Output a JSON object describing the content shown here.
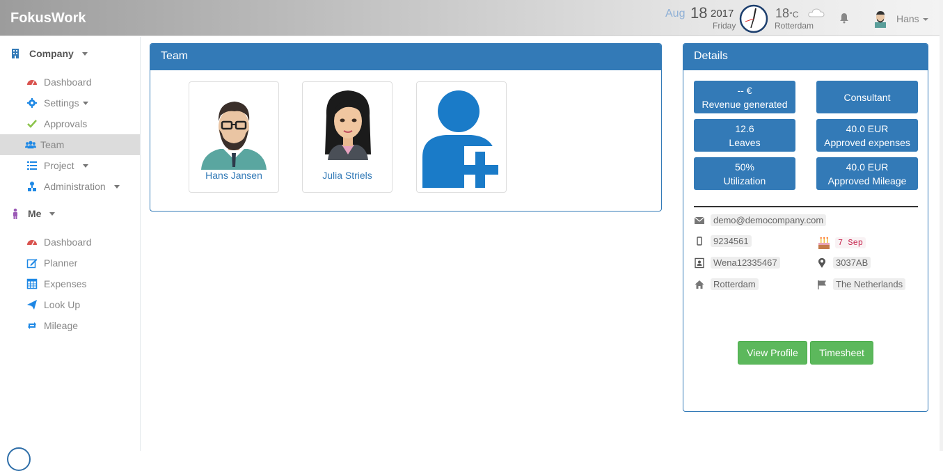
{
  "header": {
    "brand": "FokusWork",
    "date_month": "Aug",
    "date_day": "18",
    "date_year": "2017",
    "date_weekday": "Friday",
    "temperature": "18",
    "temperature_unit": "°C",
    "city": "Rotterdam",
    "user_name": "Hans"
  },
  "sidebar": {
    "company": {
      "label": "Company",
      "items": [
        {
          "label": "Dashboard",
          "icon": "dashboard-icon"
        },
        {
          "label": "Settings",
          "icon": "gear-icon"
        },
        {
          "label": "Approvals",
          "icon": "check-icon"
        },
        {
          "label": "Team",
          "icon": "users-icon"
        },
        {
          "label": "Project",
          "icon": "list-icon"
        },
        {
          "label": "Administration",
          "icon": "sitemap-icon"
        }
      ]
    },
    "me": {
      "label": "Me",
      "items": [
        {
          "label": "Dashboard",
          "icon": "dashboard-icon"
        },
        {
          "label": "Planner",
          "icon": "edit-icon"
        },
        {
          "label": "Expenses",
          "icon": "calculator-icon"
        },
        {
          "label": "Look Up",
          "icon": "paper-plane-icon"
        },
        {
          "label": "Mileage",
          "icon": "retweet-icon"
        }
      ]
    },
    "active_item": "Team"
  },
  "team": {
    "title": "Team",
    "members": [
      {
        "name": "Hans Jansen"
      },
      {
        "name": "Julia Striels"
      }
    ]
  },
  "details": {
    "title": "Details",
    "stats": [
      {
        "value": "-- €",
        "label": "Revenue generated"
      },
      {
        "value": "",
        "label": "Consultant"
      },
      {
        "value": "12.6",
        "label": "Leaves"
      },
      {
        "value": "40.0 EUR",
        "label": "Approved expenses"
      },
      {
        "value": "50%",
        "label": "Utilization"
      },
      {
        "value": "40.0 EUR",
        "label": "Approved Mileage"
      }
    ],
    "email": "demo@democompany.com",
    "phone": "9234561",
    "birthday": "7 Sep",
    "id_number": "Wena12335467",
    "postcode": "3037AB",
    "city": "Rotterdam",
    "country": "The Netherlands",
    "view_profile_label": "View Profile",
    "timesheet_label": "Timesheet"
  },
  "colors": {
    "primary": "#337ab7",
    "success": "#5cb85c",
    "sidebar_active": "#dcdcdc"
  }
}
